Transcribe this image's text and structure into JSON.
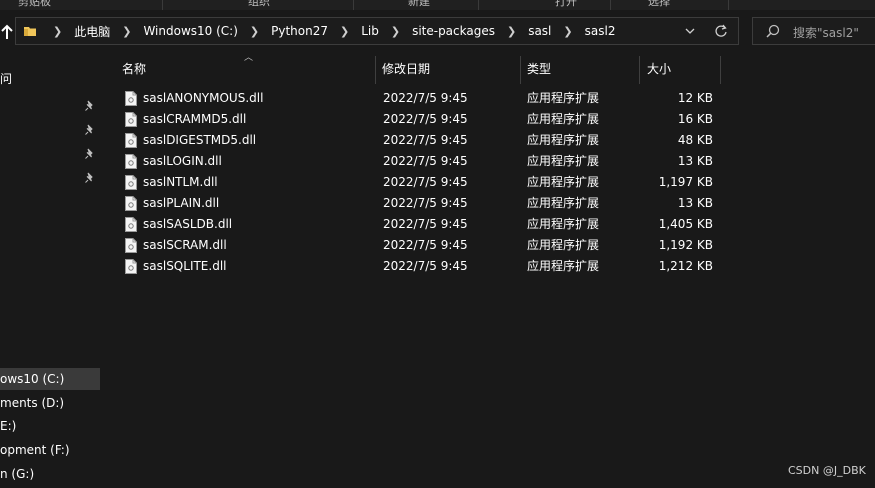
{
  "ribbon": {
    "items": [
      "剪贴板",
      "组织",
      "新建",
      "打开",
      "选择"
    ]
  },
  "address": {
    "crumbs": [
      "此电脑",
      "Windows10 (C:)",
      "Python27",
      "Lib",
      "site-packages",
      "sasl",
      "sasl2"
    ]
  },
  "search": {
    "placeholder": "搜索\"sasl2\""
  },
  "nav": {
    "top_label": "问",
    "drives": [
      "ows10 (C:)",
      "ments (D:)",
      "E:)",
      "opment (F:)",
      "n (G:)"
    ]
  },
  "columns": {
    "name": "名称",
    "date": "修改日期",
    "type": "类型",
    "size": "大小"
  },
  "files": [
    {
      "name": "saslANONYMOUS.dll",
      "date": "2022/7/5 9:45",
      "type": "应用程序扩展",
      "size": "12 KB"
    },
    {
      "name": "saslCRAMMD5.dll",
      "date": "2022/7/5 9:45",
      "type": "应用程序扩展",
      "size": "16 KB"
    },
    {
      "name": "saslDIGESTMD5.dll",
      "date": "2022/7/5 9:45",
      "type": "应用程序扩展",
      "size": "48 KB"
    },
    {
      "name": "saslLOGIN.dll",
      "date": "2022/7/5 9:45",
      "type": "应用程序扩展",
      "size": "13 KB"
    },
    {
      "name": "saslNTLM.dll",
      "date": "2022/7/5 9:45",
      "type": "应用程序扩展",
      "size": "1,197 KB"
    },
    {
      "name": "saslPLAIN.dll",
      "date": "2022/7/5 9:45",
      "type": "应用程序扩展",
      "size": "13 KB"
    },
    {
      "name": "saslSASLDB.dll",
      "date": "2022/7/5 9:45",
      "type": "应用程序扩展",
      "size": "1,405 KB"
    },
    {
      "name": "saslSCRAM.dll",
      "date": "2022/7/5 9:45",
      "type": "应用程序扩展",
      "size": "1,192 KB"
    },
    {
      "name": "saslSQLITE.dll",
      "date": "2022/7/5 9:45",
      "type": "应用程序扩展",
      "size": "1,212 KB"
    }
  ],
  "watermark": "CSDN @J_DBK",
  "colors": {
    "background": "#191919",
    "selected": "#3a3a3a",
    "folder": "#f0c65a"
  }
}
